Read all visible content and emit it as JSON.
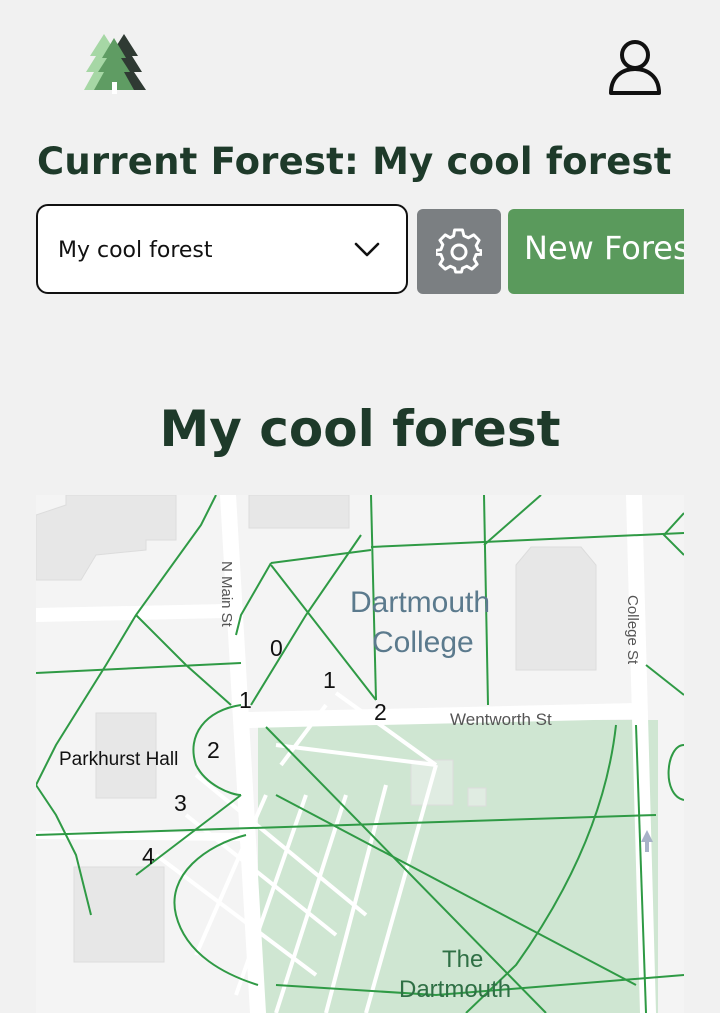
{
  "header": {
    "logo_icon": "three-pine-trees-logo",
    "user_icon": "user-profile-icon"
  },
  "current_forest": {
    "title": "Current Forest: My cool forest"
  },
  "controls": {
    "selected_forest": "My cool forest",
    "settings_icon": "gear-icon",
    "new_button_label": "New Forest"
  },
  "forest_heading": "My cool forest",
  "map": {
    "labels": {
      "street_main": "N Main St",
      "street_college": "College St",
      "street_wentworth": "Wentworth St",
      "place_college_line1": "Dartmouth",
      "place_college_line2": "College",
      "place_parkhurst": "Parkhurst Hall",
      "place_green_line1": "The",
      "place_green_line2": "Dartmouth"
    },
    "markers": [
      "0",
      "1",
      "1",
      "2",
      "2",
      "3",
      "4"
    ],
    "colors": {
      "green_area": "#cfe6d2",
      "route_lines": "#2f9a45",
      "roads": "#ffffff",
      "buildings": "#e6e6e6"
    }
  }
}
